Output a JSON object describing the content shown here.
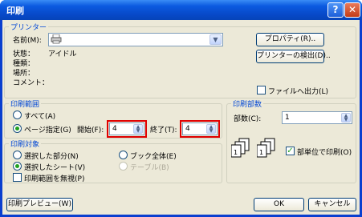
{
  "window": {
    "title": "印刷",
    "help_label": "?",
    "close_label": "✕"
  },
  "printer": {
    "group_title": "プリンター",
    "name_label": "名前(M):",
    "name_value": "",
    "properties_button": "プロパティ(R)..",
    "find_button": "プリンターの検出(D)..",
    "status_label": "状態：",
    "status_value": "アイドル",
    "type_label": "種類：",
    "location_label": "場所：",
    "comment_label": "コメント：",
    "print_to_file_label": "ファイルへ出力(L)",
    "print_to_file_checked": false
  },
  "range": {
    "group_title": "印刷範囲",
    "all_label": "すべて(A)",
    "pages_label": "ページ指定(G)",
    "from_label": "開始(F):",
    "from_value": "4",
    "to_label": "終了(T):",
    "to_value": "4",
    "selected": "pages"
  },
  "target": {
    "group_title": "印刷対象",
    "selection_label": "選択した部分(N)",
    "active_sheet_label": "選択したシート(V)",
    "ignore_area_label": "印刷範囲を無視(P)",
    "workbook_label": "ブック全体(E)",
    "table_label": "テーブル(B)",
    "selected": "active_sheet"
  },
  "copies": {
    "group_title": "印刷部数",
    "count_label": "部数(C):",
    "count_value": "1",
    "collate_label": "部単位で印刷(O)",
    "collate_checked": true
  },
  "footer": {
    "preview_button": "印刷プレビュー(W)",
    "ok_button": "OK",
    "cancel_button": "キャンセル"
  },
  "icons": {
    "dropdown": "▼",
    "spin_up": "▲",
    "spin_down": "▼",
    "check": "✓"
  }
}
